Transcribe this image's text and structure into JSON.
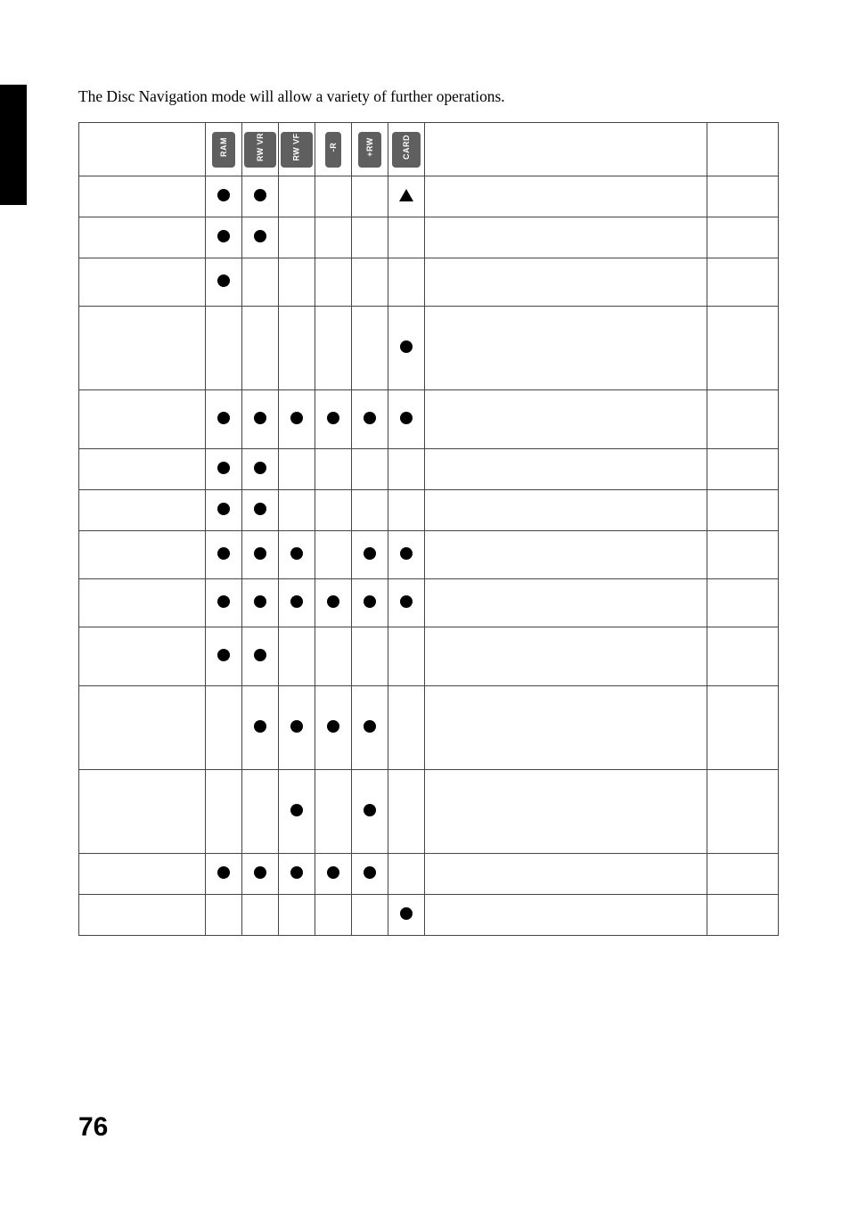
{
  "intro": "The Disc Navigation mode will allow a variety of further operations.",
  "media": [
    "RAM",
    "RW VR",
    "RW VF",
    "-R",
    "+RW",
    "CARD"
  ],
  "marks": {
    "dot": "●",
    "triangle": "▲"
  },
  "rows": [
    {
      "key": "r0",
      "height": "",
      "cells": [
        "dot",
        "dot",
        "",
        "",
        "",
        "triangle"
      ]
    },
    {
      "key": "r1",
      "height": "",
      "cells": [
        "dot",
        "dot",
        "",
        "",
        "",
        ""
      ]
    },
    {
      "key": "r2",
      "height": "semi",
      "cells": [
        "dot",
        "",
        "",
        "",
        "",
        ""
      ]
    },
    {
      "key": "r3",
      "height": "tall",
      "cells": [
        "",
        "",
        "",
        "",
        "",
        "dot"
      ]
    },
    {
      "key": "r4",
      "height": "medium",
      "cells": [
        "dot",
        "dot",
        "dot",
        "dot",
        "dot",
        "dot"
      ]
    },
    {
      "key": "r5",
      "height": "",
      "cells": [
        "dot",
        "dot",
        "",
        "",
        "",
        ""
      ]
    },
    {
      "key": "r6",
      "height": "",
      "cells": [
        "dot",
        "dot",
        "",
        "",
        "",
        ""
      ]
    },
    {
      "key": "r7",
      "height": "semi",
      "cells": [
        "dot",
        "dot",
        "dot",
        "",
        "dot",
        "dot"
      ]
    },
    {
      "key": "r8",
      "height": "semi",
      "cells": [
        "dot",
        "dot",
        "dot",
        "dot",
        "dot",
        "dot"
      ]
    },
    {
      "key": "r9",
      "height": "medium",
      "cells": [
        "dot",
        "dot",
        "",
        "",
        "",
        ""
      ]
    },
    {
      "key": "r10",
      "height": "tall",
      "cells": [
        "",
        "dot",
        "dot",
        "dot",
        "dot",
        ""
      ]
    },
    {
      "key": "r11",
      "height": "tall",
      "cells": [
        "",
        "",
        "dot",
        "",
        "dot",
        ""
      ]
    },
    {
      "key": "r12",
      "height": "",
      "cells": [
        "dot",
        "dot",
        "dot",
        "dot",
        "dot",
        ""
      ]
    },
    {
      "key": "r13",
      "height": "",
      "cells": [
        "",
        "",
        "",
        "",
        "",
        "dot"
      ]
    }
  ],
  "page_number": "76"
}
